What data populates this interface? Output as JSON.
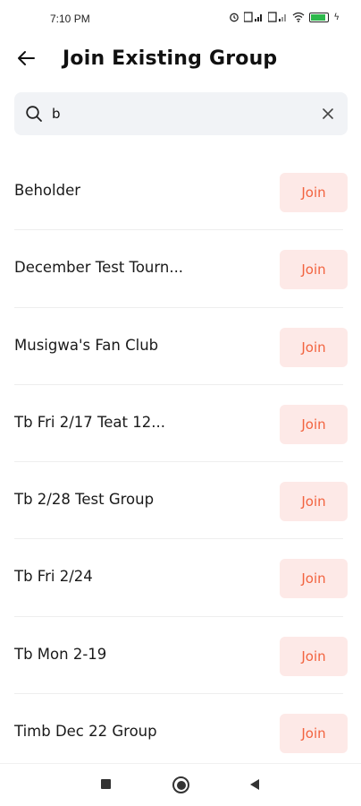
{
  "status_bar": {
    "time": "7:10 PM",
    "icons": [
      "alarm-icon",
      "signal-icon",
      "signal-icon",
      "wifi-icon",
      "battery-icon",
      "charging-icon"
    ],
    "battery_level": "91",
    "battery_color": "#2db84b"
  },
  "header": {
    "title": "Join Existing Group",
    "back_icon": "arrow-left-icon"
  },
  "search": {
    "value": "b",
    "placeholder": "",
    "search_icon": "search-icon",
    "clear_icon": "close-icon"
  },
  "groups": [
    {
      "name": "Beholder",
      "button": "Join"
    },
    {
      "name": "December Test Tourn...",
      "button": "Join"
    },
    {
      "name": "Musigwa's Fan Club",
      "button": "Join"
    },
    {
      "name": "Tb Fri 2/17 Teat 12...",
      "button": "Join"
    },
    {
      "name": "Tb 2/28 Test Group",
      "button": "Join"
    },
    {
      "name": "Tb Fri 2/24",
      "button": "Join"
    },
    {
      "name": "Tb Mon 2-19",
      "button": "Join"
    },
    {
      "name": "Timb Dec 22 Group",
      "button": "Join"
    }
  ],
  "colors": {
    "accent": "#f2633f",
    "accent_bg": "#fde9e7",
    "search_bg": "#f1f3f6"
  },
  "nav_bar": {
    "icons": [
      "recent-apps-icon",
      "home-icon",
      "back-icon"
    ]
  }
}
